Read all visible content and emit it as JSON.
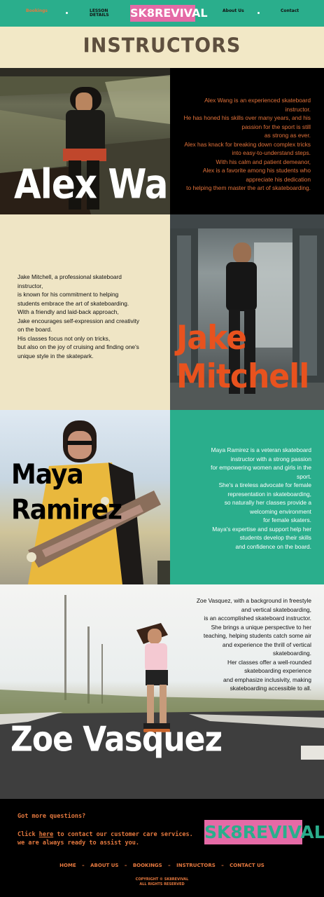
{
  "nav": {
    "items": [
      "Bookings",
      "LESSON DETAILS",
      "About Us",
      "Contact"
    ],
    "logo": "SK8REVIVAL"
  },
  "page_title": "INSTRUCTORS",
  "instructors": [
    {
      "name_lines": [
        "Alex Wang"
      ],
      "bio": [
        "Alex Wang is an experienced skateboard",
        "instructor.",
        "He has honed his skills over many years, and his",
        "passion for the sport is still",
        "as strong as ever.",
        "Alex has knack for breaking down complex tricks",
        "into easy-to-understand steps.",
        "With his calm and patient demeanor,",
        "Alex is a favorite among his students who",
        "appreciate his dedication",
        "to helping them master the art of skateboarding."
      ]
    },
    {
      "name_lines": [
        "Jake",
        "Mitchell"
      ],
      "bio": [
        "Jake Mitchell, a professional skateboard",
        "instructor,",
        " is known for his commitment to helping",
        "students embrace the art of skateboarding.",
        " With a friendly and laid-back approach,",
        " Jake encourages self-expression and creativity",
        "on the board.",
        " His classes focus not only on tricks,",
        " but also on the joy of cruising and finding one's",
        "unique style in the skatepark."
      ]
    },
    {
      "name_lines": [
        "Maya",
        "Ramirez"
      ],
      "bio": [
        "Maya Ramirez is a veteran skateboard",
        "instructor with a strong passion",
        "for empowering women and girls in the",
        "sport.",
        "She's a tireless advocate for female",
        "representation in skateboarding,",
        "so naturally her classes provide a",
        "welcoming environment",
        "for female skaters.",
        "Maya's expertise and support help her",
        "students develop their skills",
        "and confidence on the board."
      ]
    },
    {
      "name_lines": [
        "Zoe Vasquez"
      ],
      "bio": [
        "Zoe Vasquez, with a background in freestyle",
        "and vertical skateboarding,",
        "is an accomplished skateboard instructor.",
        "She brings a unique perspective to her",
        "teaching, helping students catch some air",
        "and experience the thrill of vertical",
        "skateboarding.",
        "Her classes offer a well-rounded",
        "skateboarding experience",
        "and emphasize inclusivity, making",
        "skateboarding accessible to all."
      ]
    }
  ],
  "footer": {
    "question": "Got more questions?",
    "help_prefix": "Click ",
    "help_link": "here",
    "help_suffix": " to contact our customer care services.",
    "help_line2": "we are always ready to assist you.",
    "logo": "SK8REVIVAL",
    "links": [
      "HOME",
      "ABOUT US",
      "BOOKINGS",
      "INSTRUCTORS",
      "CONTACT US"
    ],
    "separator": "–",
    "copyright": [
      "COPYRIGHT © SK8REVIVAL",
      "ALL RIGHTS RESERVED"
    ]
  },
  "colors": {
    "teal": "#2aae8c",
    "cream": "#f2e8c6",
    "pink": "#e56aa6",
    "orange": "#e2723a",
    "brown": "#5e4f3e"
  }
}
